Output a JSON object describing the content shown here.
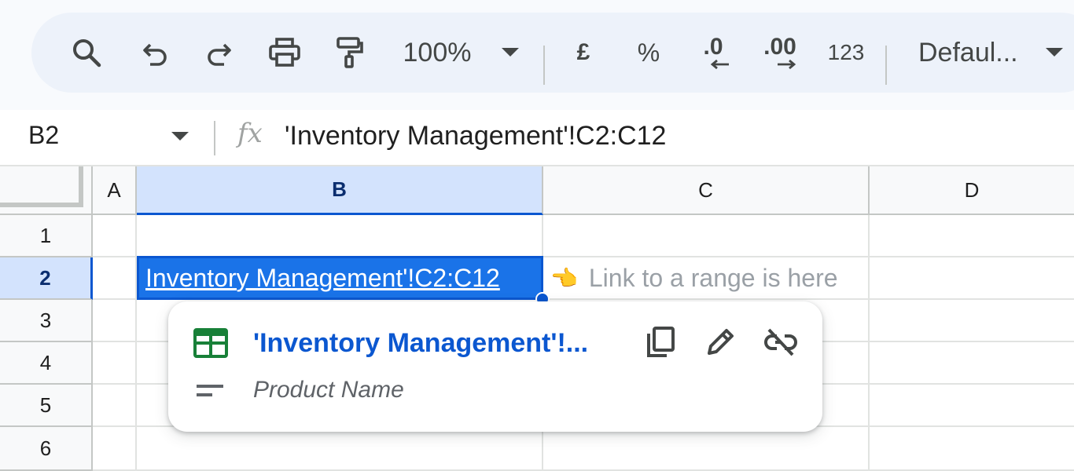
{
  "toolbar": {
    "zoom_value": "100%",
    "currency_label": "£",
    "percent_label": "%",
    "decrease_decimal_label": ".0",
    "increase_decimal_label": ".00",
    "more_formats_label": "123",
    "font_value": "Defaul..."
  },
  "formula_bar": {
    "cell_ref": "B2",
    "fx_label": "fx",
    "formula": "'Inventory Management'!C2:C12"
  },
  "grid": {
    "columns": [
      "A",
      "B",
      "C",
      "D"
    ],
    "rows": [
      "1",
      "2",
      "3",
      "4",
      "5",
      "6"
    ],
    "active_column": "B",
    "active_row": "2",
    "b2_value": "Inventory Management'!C2:C12",
    "c2_note_emoji": "👈",
    "c2_note": "Link to a range is here"
  },
  "popup": {
    "title": "'Inventory Management'!...",
    "subtitle": "Product Name",
    "sheet_icon_color": "#188038",
    "link_color": "#0b57d0"
  },
  "icons": [
    "search-icon",
    "undo-icon",
    "redo-icon",
    "print-icon",
    "paint-format-icon",
    "zoom-dropdown-icon",
    "font-dropdown-icon",
    "namebox-dropdown-icon",
    "sheets-grid-icon",
    "copy-icon",
    "edit-icon",
    "unlink-icon",
    "short-text-icon"
  ]
}
